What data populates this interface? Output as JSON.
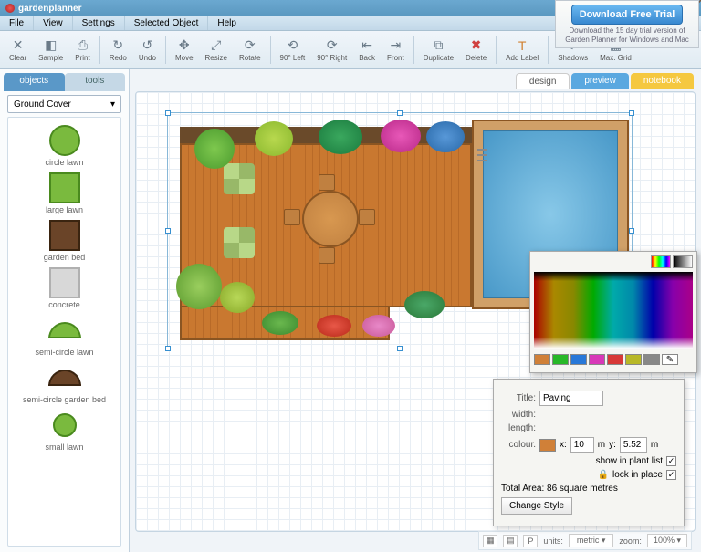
{
  "app": {
    "name": "gardenplanner"
  },
  "menu": [
    "File",
    "View",
    "Settings",
    "Selected Object",
    "Help"
  ],
  "toolbar": [
    {
      "label": "Clear"
    },
    {
      "label": "Sample"
    },
    {
      "label": "Print"
    },
    {
      "label": "Redo"
    },
    {
      "label": "Undo"
    },
    {
      "label": "Move"
    },
    {
      "label": "Resize"
    },
    {
      "label": "Rotate"
    },
    {
      "label": "90° Left"
    },
    {
      "label": "90° Right"
    },
    {
      "label": "Back"
    },
    {
      "label": "Front"
    },
    {
      "label": "Duplicate"
    },
    {
      "label": "Delete"
    },
    {
      "label": "Add Label"
    },
    {
      "label": "Shadows"
    },
    {
      "label": "Max. Grid"
    }
  ],
  "toolbar_groups": [
    3,
    2,
    3,
    4,
    2,
    1,
    2
  ],
  "panel": {
    "tabs": [
      "objects",
      "tools"
    ],
    "active_tab": 0,
    "category": "Ground Cover",
    "items": [
      {
        "name": "circle lawn",
        "shape": "circle",
        "fill": "#7aba3e",
        "stroke": "#4a8a1e"
      },
      {
        "name": "large lawn",
        "shape": "square",
        "fill": "#7aba3e",
        "stroke": "#4a8a1e"
      },
      {
        "name": "garden bed",
        "shape": "square",
        "fill": "#6a4428",
        "stroke": "#3a2410"
      },
      {
        "name": "concrete",
        "shape": "square",
        "fill": "#d8d8d8",
        "stroke": "#b0b0b0"
      },
      {
        "name": "semi-circle lawn",
        "shape": "semicircle",
        "fill": "#7aba3e",
        "stroke": "#4a8a1e"
      },
      {
        "name": "semi-circle garden bed",
        "shape": "semicircle",
        "fill": "#6a4428",
        "stroke": "#3a2410"
      },
      {
        "name": "small lawn",
        "shape": "circle",
        "fill": "#7aba3e",
        "stroke": "#4a8a1e"
      }
    ]
  },
  "canvas_tabs": [
    "design",
    "preview",
    "notebook"
  ],
  "properties": {
    "title_label": "Title:",
    "title_value": "Paving",
    "width_label": "width:",
    "length_label": "length:",
    "colour_label": "colour.",
    "colour_value": "#d08038",
    "x_label": "x:",
    "x_value": "10",
    "x_unit": "m",
    "y_label": "y:",
    "y_value": "5.52",
    "y_unit": "m",
    "show_label": "show in plant list",
    "show_checked": true,
    "lock_label": "lock in place",
    "lock_checked": true,
    "area_label": "Total Area: 86 square metres",
    "button": "Change Style"
  },
  "status": {
    "units_label": "units:",
    "units_value": "metric",
    "zoom_label": "zoom:",
    "zoom_value": "100%"
  },
  "promo": {
    "button": "Download Free Trial",
    "text": "Download the 15 day trial version of Garden Planner for Windows and Mac"
  }
}
